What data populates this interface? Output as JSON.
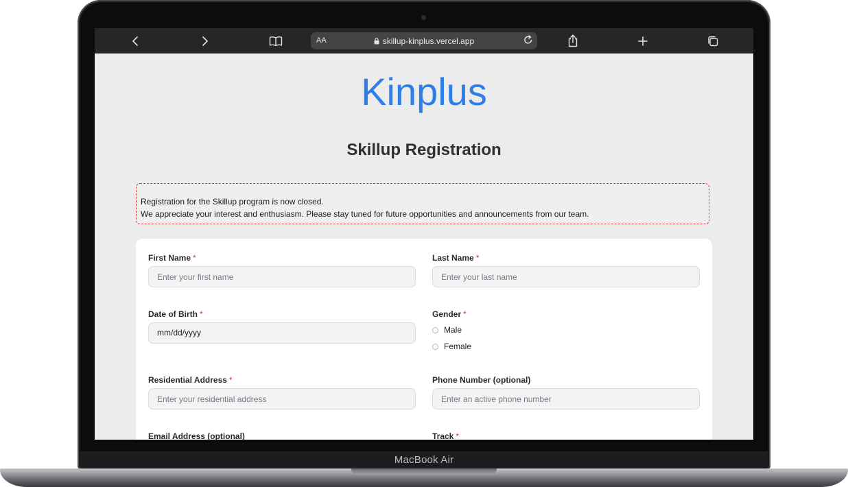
{
  "device": {
    "label": "MacBook Air"
  },
  "browser": {
    "text_size_label": "AA",
    "url": "skillup-kinplus.vercel.app",
    "icons": [
      "chevron-left-icon",
      "chevron-right-icon",
      "book-icon",
      "lock-icon",
      "reload-icon",
      "share-icon",
      "plus-icon",
      "tabs-icon"
    ]
  },
  "page": {
    "logo_text": "Kinplus",
    "title": "Skillup Registration",
    "notice": {
      "line1": "Registration for the Skillup program is now closed.",
      "line2": "We appreciate your interest and enthusiasm. Please stay tuned for future opportunities and announcements from our team."
    },
    "form": {
      "required_marker": "*",
      "first_name": {
        "label": "First Name",
        "placeholder": "Enter your first name"
      },
      "last_name": {
        "label": "Last Name",
        "placeholder": "Enter your last name"
      },
      "dob": {
        "label": "Date of Birth",
        "value": "mm/dd/yyyy"
      },
      "gender": {
        "label": "Gender",
        "options": [
          "Male",
          "Female"
        ]
      },
      "address": {
        "label": "Residential Address",
        "placeholder": "Enter your residential address"
      },
      "phone": {
        "label": "Phone Number (optional)",
        "placeholder": "Enter an active phone number"
      },
      "email": {
        "label": "Email Address (optional)"
      },
      "track": {
        "label": "Track"
      }
    }
  },
  "colors": {
    "brand_blue": "#2f7fe8",
    "required_red": "#e0313b"
  }
}
